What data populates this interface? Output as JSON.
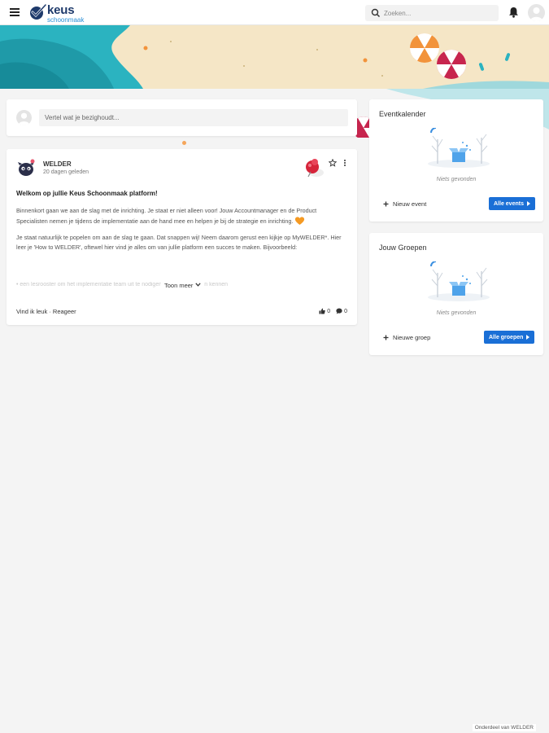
{
  "header": {
    "logo_text": "keus",
    "logo_subtext": "schoonmaak",
    "search_placeholder": "Zoeken...",
    "menu_icon": "hamburger-icon",
    "notification_icon": "bell-icon",
    "profile_icon": "user-avatar-icon"
  },
  "compose": {
    "placeholder": "Vertel wat je bezighoudt..."
  },
  "post": {
    "author": "WELDER",
    "time": "20 dagen geleden",
    "title": "Welkom op jullie Keus Schoonmaak platform!",
    "paragraph1": "Binnenkort gaan we aan de slag met de inrichting. Je staat er niet alleen voor! Jouw Accountmanager en de Product Specialisten nemen je tijdens de implementatie aan de hand mee en helpen je bij de strategie en inrichting.",
    "paragraph2": "Je staat natuurlijk te popelen om aan de slag te gaan. Dat snappen wij! Neem daarom gerust een kijkje op MyWELDER*. Hier leer je 'How to WELDER', oftewel hier vind je alles om van jullie platform een succes te maken. Bijvoorbeeld:",
    "faded_line": "• een lesrooster om het implementatie team uit te nodigen en elkaar te leren kennen",
    "show_more": "Toon meer",
    "like_label": "Vind ik leuk",
    "separator": "·",
    "reply_label": "Reageer",
    "like_count": "0",
    "comment_count": "0"
  },
  "events_widget": {
    "title": "Eventkalender",
    "empty_text": "Niets gevonden",
    "new_label": "Nieuw event",
    "all_label": "Alle events"
  },
  "groups_widget": {
    "title": "Jouw Groepen",
    "empty_text": "Niets gevonden",
    "new_label": "Nieuwe groep",
    "all_label": "Alle groepen"
  },
  "footer": {
    "text": "Onderdeel van WELDER"
  },
  "colors": {
    "brand_navy": "#1e3a6b",
    "brand_blue": "#2a8fd6",
    "button_blue": "#1a6fd6",
    "banner_sand": "#f5e6c6",
    "banner_sea": "#2bb3c0"
  }
}
